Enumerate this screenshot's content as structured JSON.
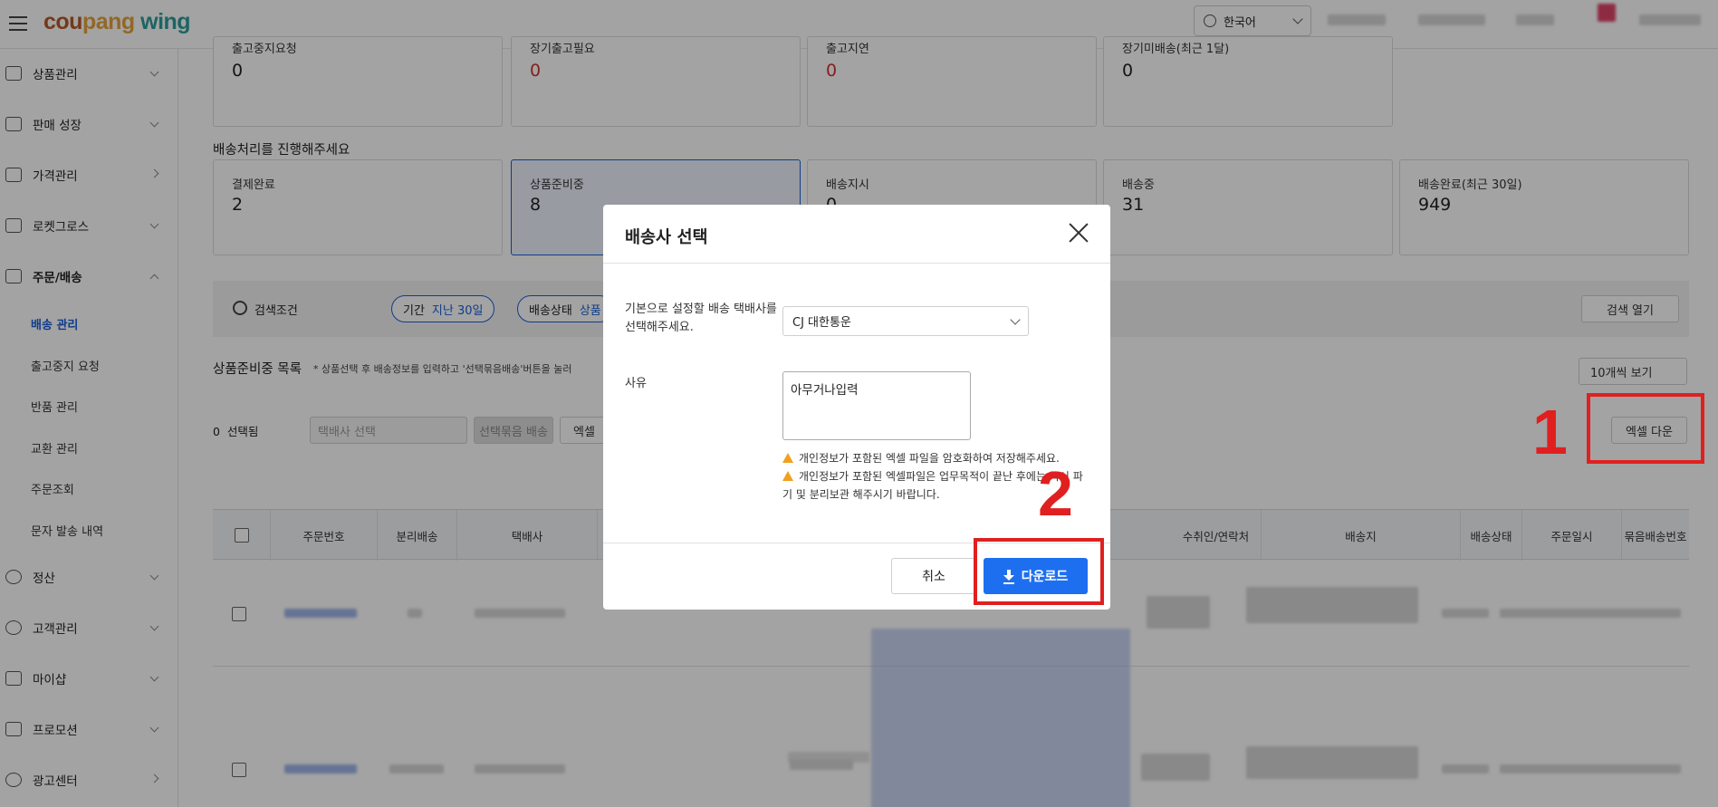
{
  "header": {
    "logo": {
      "part1": "cou",
      "part2": "pang",
      "part3": " wing"
    },
    "language": "한국어"
  },
  "sidebar": {
    "items": [
      {
        "label": "상품관리"
      },
      {
        "label": "판매 성장"
      },
      {
        "label": "가격관리"
      },
      {
        "label": "로켓그로스"
      },
      {
        "label": "주문/배송"
      },
      {
        "label": "정산"
      },
      {
        "label": "고객관리"
      },
      {
        "label": "마이샵"
      },
      {
        "label": "프로모션"
      },
      {
        "label": "광고센터"
      }
    ],
    "sub_items": [
      {
        "label": "배송 관리"
      },
      {
        "label": "출고중지 요청"
      },
      {
        "label": "반품 관리"
      },
      {
        "label": "교환 관리"
      },
      {
        "label": "주문조회"
      },
      {
        "label": "문자 발송 내역"
      }
    ]
  },
  "top_cards": [
    {
      "label": "출고중지요청",
      "value": "0"
    },
    {
      "label": "장기출고필요",
      "value": "0"
    },
    {
      "label": "출고지연",
      "value": "0"
    },
    {
      "label": "장기미배송(최근 1달)",
      "value": "0"
    }
  ],
  "status_section": {
    "title": "배송처리를 진행해주세요",
    "cards": [
      {
        "label": "결제완료",
        "value": "2"
      },
      {
        "label": "상품준비중",
        "value": "8"
      },
      {
        "label": "배송지시",
        "value": "0"
      },
      {
        "label": "배송중",
        "value": "31"
      },
      {
        "label": "배송완료(최근 30일)",
        "value": "949"
      }
    ]
  },
  "filter": {
    "search_label": "검색조건",
    "period_label": "기간",
    "period_value": "지난 30일",
    "status_label": "배송상태",
    "status_value": "상품",
    "open_search": "검색 열기"
  },
  "list": {
    "title": "상품준비중 목록",
    "hint": "* 상품선택 후 배송정보를 입력하고 '선택묶음배송'버튼을 눌러",
    "page_size": "10개씩 보기",
    "selected_count": "0",
    "selected_label": "선택됨",
    "carrier_placeholder": "택배사 선택",
    "bundle_button": "선택묶음 배송",
    "excel_button_small": "엑셀",
    "excel_download": "엑셀 다운"
  },
  "table": {
    "headers": [
      "주문번호",
      "분리배송",
      "택배사",
      "수취인/연락처",
      "배송지",
      "배송상태",
      "주문일시",
      "묶음배송번호"
    ]
  },
  "modal": {
    "title": "배송사 선택",
    "carrier_label": "기본으로 설정할 배송 택배사를 선택해주세요.",
    "carrier_value": "CJ 대한통운",
    "reason_label": "사유",
    "reason_value": "아무거나입력",
    "notice1": "개인정보가 포함된 엑셀 파일을 암호화하여 저장해주세요.",
    "notice2": "개인정보가 포함된 엑셀파일은 업무목적이 끝난 후에는 즉시 파기 및 분리보관 해주시기 바랍니다.",
    "cancel": "취소",
    "download": "다운로드"
  },
  "annotations": {
    "first": "1",
    "second": "2"
  },
  "colors": {
    "accent": "#1e6ff0",
    "annotation": "#e02020",
    "value_red": "#d32f2f"
  },
  "icons": [
    "menu-icon",
    "globe-icon",
    "close-icon",
    "warning-icon",
    "download-icon",
    "search-icon"
  ]
}
